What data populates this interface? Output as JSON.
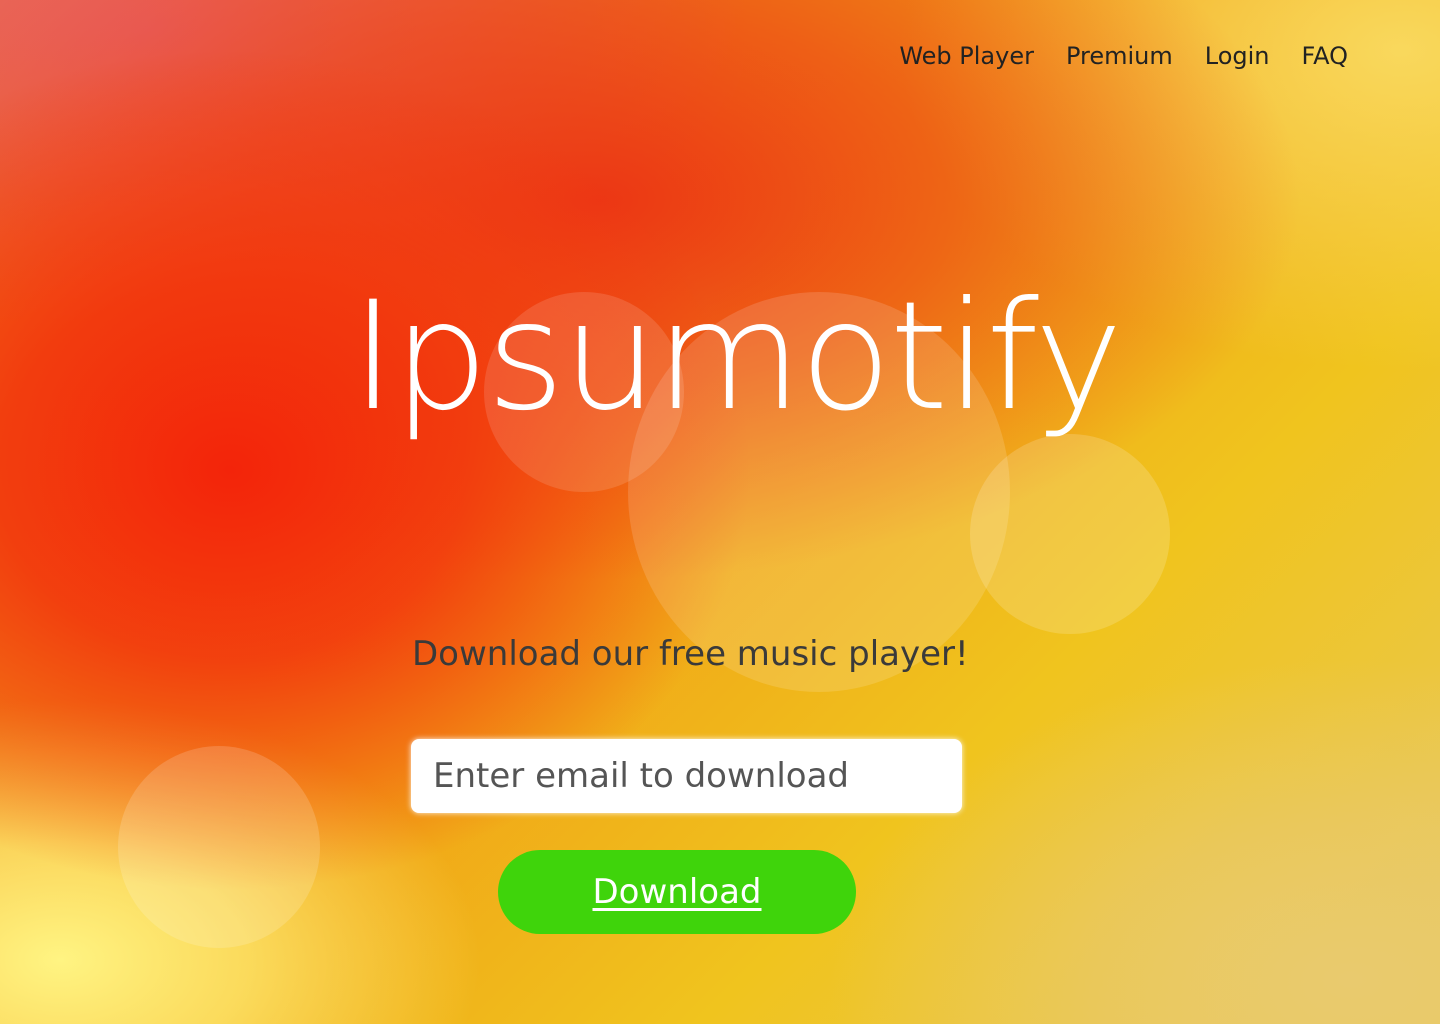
{
  "nav": {
    "items": [
      "Web Player",
      "Premium",
      "Login",
      "FAQ"
    ]
  },
  "hero": {
    "title": "Ipsumotify",
    "subtitle": "Download our free music player!"
  },
  "form": {
    "email_placeholder": "Enter email to download",
    "email_value": "",
    "button_label": "Download"
  },
  "colors": {
    "button": "#3fd40b",
    "title_text": "#ffffff",
    "nav_text": "#222222"
  }
}
